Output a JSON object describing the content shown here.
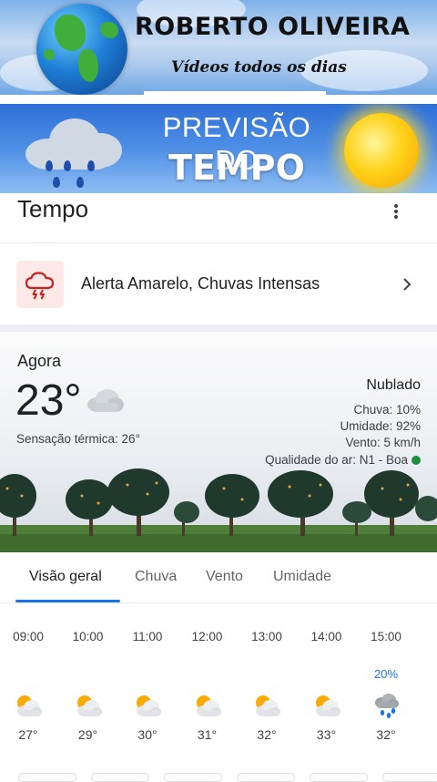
{
  "banner_channel": {
    "title": "ROBERTO OLIVEIRA",
    "subtitle": "Vídeos todos os dias"
  },
  "banner_forecast": {
    "line1": "PREVISÃO DO",
    "line2": "TEMPO"
  },
  "header": {
    "title": "Tempo",
    "menu_icon": "more-vert-icon"
  },
  "alert": {
    "icon": "thunderstorm-icon",
    "text": "Alerta Amarelo, Chuvas Intensas"
  },
  "now": {
    "label": "Agora",
    "temperature": "23°",
    "feels_like": "Sensação térmica: 26°",
    "condition": "Nublado",
    "rain": "Chuva: 10%",
    "humidity": "Umidade: 92%",
    "wind": "Vento: 5 km/h",
    "air_quality": "Qualidade do ar: N1 - Boa",
    "air_quality_color": "#1e8e3e"
  },
  "tabs": [
    {
      "label": "Visão geral",
      "active": true
    },
    {
      "label": "Chuva",
      "active": false
    },
    {
      "label": "Vento",
      "active": false
    },
    {
      "label": "Umidade",
      "active": false
    }
  ],
  "hourly": [
    {
      "time": "09:00",
      "prob": "",
      "icon": "partly-cloudy-icon",
      "temp": "27°"
    },
    {
      "time": "10:00",
      "prob": "",
      "icon": "partly-cloudy-icon",
      "temp": "29°"
    },
    {
      "time": "11:00",
      "prob": "",
      "icon": "partly-cloudy-icon",
      "temp": "30°"
    },
    {
      "time": "12:00",
      "prob": "",
      "icon": "partly-cloudy-icon",
      "temp": "31°"
    },
    {
      "time": "13:00",
      "prob": "",
      "icon": "partly-cloudy-icon",
      "temp": "32°"
    },
    {
      "time": "14:00",
      "prob": "",
      "icon": "partly-cloudy-icon",
      "temp": "33°"
    },
    {
      "time": "15:00",
      "prob": "20%",
      "icon": "rain-cloud-icon",
      "temp": "32°"
    }
  ],
  "colors": {
    "accent": "#1a73e8",
    "alert_bg": "#fce8e6",
    "alert_icon": "#c5221f"
  }
}
